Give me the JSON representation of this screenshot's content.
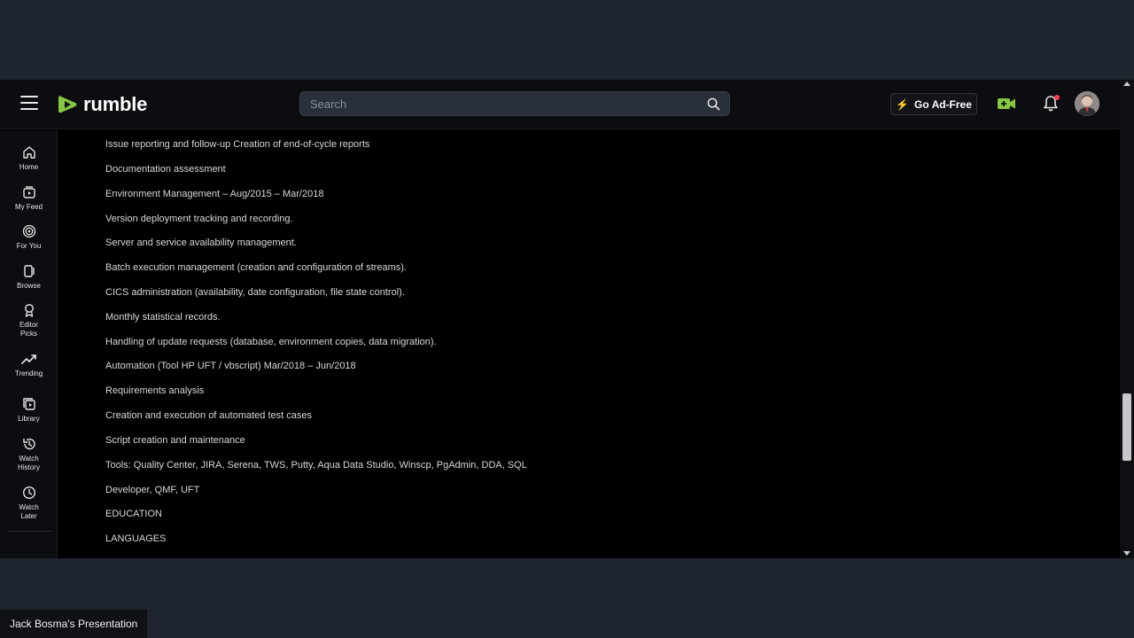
{
  "header": {
    "logo_text": "rumble",
    "search_placeholder": "Search",
    "go_adfree_label": "Go Ad-Free"
  },
  "sidebar": {
    "items": [
      {
        "label": "Home",
        "icon": "home-icon"
      },
      {
        "label": "My Feed",
        "icon": "feed-icon"
      },
      {
        "label": "For You",
        "icon": "target-icon"
      },
      {
        "label": "Browse",
        "icon": "browse-icon"
      },
      {
        "label": "Editor Picks",
        "icon": "award-icon"
      },
      {
        "label": "Trending",
        "icon": "trending-icon"
      },
      {
        "label": "Library",
        "icon": "library-icon"
      },
      {
        "label": "Watch History",
        "icon": "history-icon"
      },
      {
        "label": "Watch Later",
        "icon": "clock-icon"
      }
    ]
  },
  "content": {
    "lines": [
      "Issue reporting and follow-up Creation of end-of-cycle reports",
      "Documentation assessment",
      "Environment Management – Aug/2015 – Mar/2018",
      "Version deployment tracking and recording.",
      "Server and service availability management.",
      "Batch execution management (creation and configuration of streams).",
      "CICS administration (availability, date configuration, file state control).",
      "Monthly statistical records.",
      "Handling of update requests (database, environment copies, data migration).",
      "Automation (Tool HP UFT / vbscript) Mar/2018 – Jun/2018",
      "Requirements analysis",
      "Creation and execution of automated test cases",
      "Script creation and maintenance",
      "Tools: Quality Center, JIRA, Serena, TWS, Putty, Aqua Data Studio, Winscp, PgAdmin, DDA, SQL",
      "Developer, QMF, UFT",
      "EDUCATION",
      "LANGUAGES"
    ]
  },
  "caption": "Jack Bosma's Presentation",
  "colors": {
    "brand_green": "#85c742",
    "notification_dot": "#ff3a4a",
    "page_bg": "#000000",
    "frame_bg": "#1f252e"
  }
}
